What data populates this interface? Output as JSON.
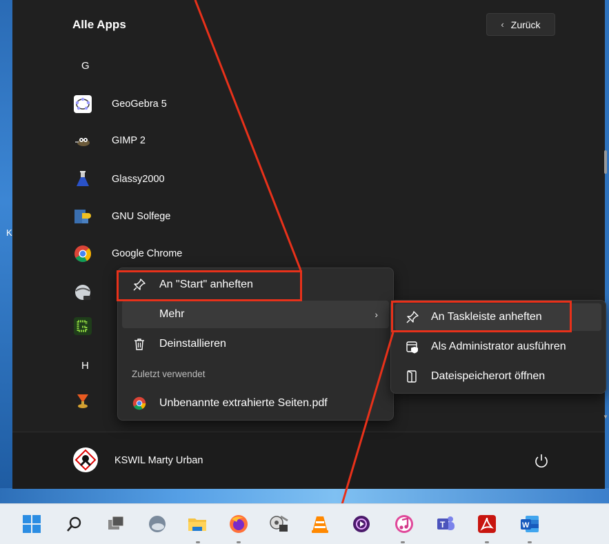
{
  "desktop": {
    "edge_letter": "K"
  },
  "start_menu": {
    "title": "Alle Apps",
    "back_label": "Zurück",
    "sections": [
      {
        "letter": "G"
      },
      {
        "letter": "H"
      }
    ],
    "apps": [
      {
        "label": "GeoGebra 5",
        "icon": "geogebra-icon"
      },
      {
        "label": "GIMP 2",
        "icon": "gimp-icon"
      },
      {
        "label": "Glassy2000",
        "icon": "glassy-flask-icon"
      },
      {
        "label": "GNU Solfege",
        "icon": "gnu-solfege-icon"
      },
      {
        "label": "Google Chrome",
        "icon": "chrome-icon"
      },
      {
        "label": "",
        "icon": "google-earth-pro-icon"
      },
      {
        "label": "",
        "icon": "green-app-icon"
      },
      {
        "label": "",
        "icon": "h-app-icon"
      }
    ],
    "user": {
      "name": "KSWIL Marty Urban"
    }
  },
  "context_menu": {
    "items": [
      {
        "label": "An \"Start\" anheften",
        "icon": "pin-icon"
      },
      {
        "label": "Mehr",
        "icon": "",
        "has_submenu": true
      },
      {
        "label": "Deinstallieren",
        "icon": "trash-icon"
      }
    ],
    "recent_section": "Zuletzt verwendet",
    "recent_items": [
      {
        "label": "Unbenannte extrahierte Seiten.pdf",
        "icon": "chrome-icon"
      }
    ]
  },
  "submenu": {
    "items": [
      {
        "label": "An Taskleiste anheften",
        "icon": "pin-icon"
      },
      {
        "label": "Als Administrator ausführen",
        "icon": "admin-shield-icon"
      },
      {
        "label": "Dateispeicherort öffnen",
        "icon": "folder-open-icon"
      }
    ]
  },
  "taskbar": {
    "items": [
      {
        "name": "start-button",
        "icon": "windows-icon"
      },
      {
        "name": "search-button",
        "icon": "search-icon"
      },
      {
        "name": "task-view-button",
        "icon": "task-view-icon"
      },
      {
        "name": "weather-widget",
        "icon": "weather-icon"
      },
      {
        "name": "file-explorer",
        "icon": "folder-icon"
      },
      {
        "name": "firefox",
        "icon": "firefox-icon"
      },
      {
        "name": "unknown-app",
        "icon": "film-icon"
      },
      {
        "name": "vlc",
        "icon": "vlc-icon"
      },
      {
        "name": "media-player",
        "icon": "media-player-icon"
      },
      {
        "name": "itunes",
        "icon": "itunes-icon"
      },
      {
        "name": "teams",
        "icon": "teams-icon"
      },
      {
        "name": "acrobat",
        "icon": "acrobat-icon"
      },
      {
        "name": "word",
        "icon": "word-icon"
      }
    ]
  },
  "colors": {
    "highlight": "#e8311a",
    "menu_bg": "#202020",
    "taskbar_bg": "#e9eef3"
  }
}
